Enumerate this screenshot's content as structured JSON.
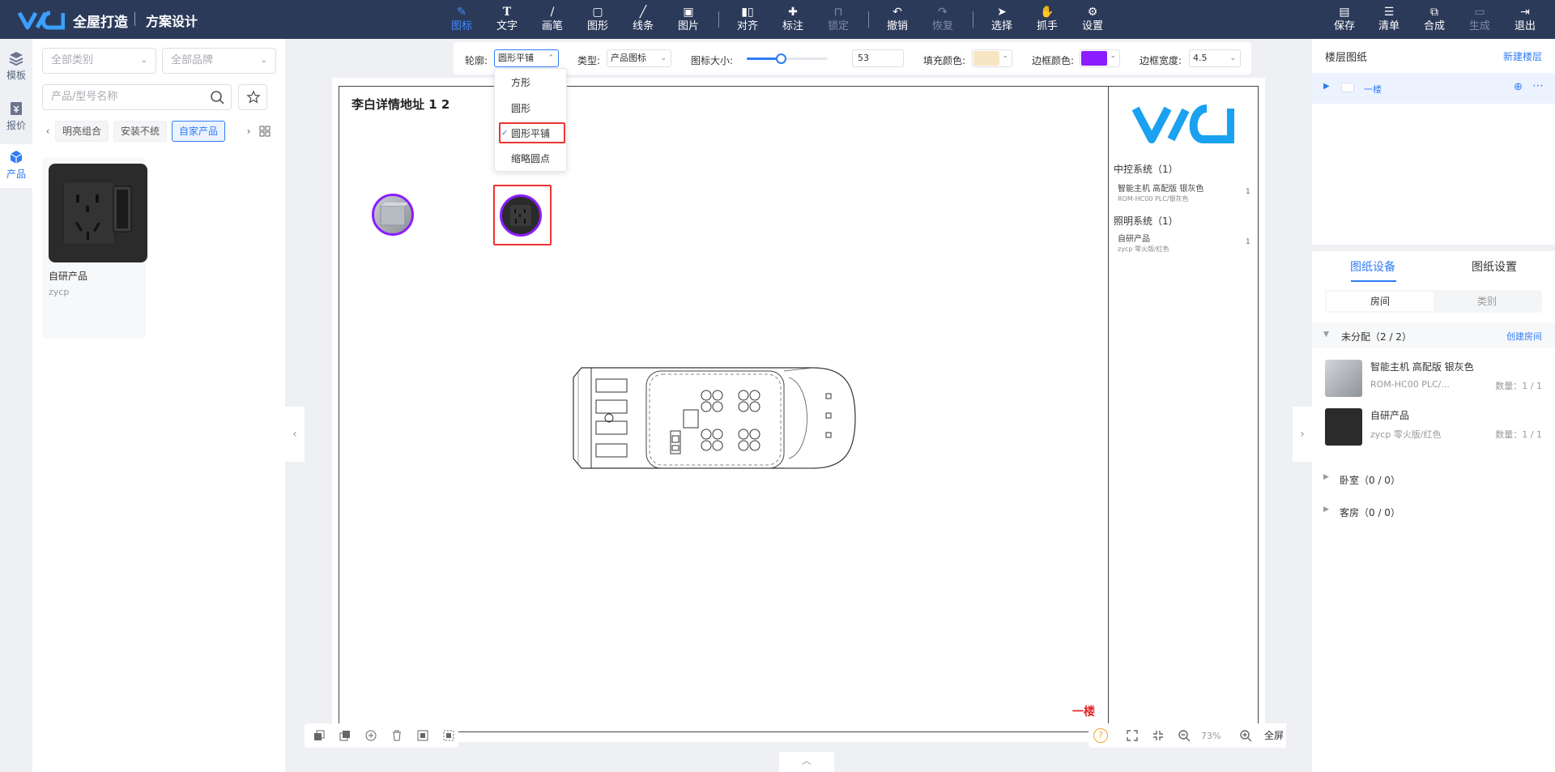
{
  "header": {
    "app_title": "全屋打造",
    "page_title": "方案设计"
  },
  "toolbar": {
    "tools": [
      {
        "id": "icon",
        "label": "图标",
        "icon": "icon-tool-icon",
        "active": true
      },
      {
        "id": "text",
        "label": "文字",
        "icon": "text-icon"
      },
      {
        "id": "brush",
        "label": "画笔",
        "icon": "brush-icon"
      },
      {
        "id": "shape",
        "label": "图形",
        "icon": "shape-icon"
      },
      {
        "id": "line",
        "label": "线条",
        "icon": "line-icon"
      },
      {
        "id": "image",
        "label": "图片",
        "icon": "image-icon"
      },
      {
        "id": "align",
        "label": "对齐",
        "icon": "align-icon"
      },
      {
        "id": "annotate",
        "label": "标注",
        "icon": "pin-icon"
      },
      {
        "id": "lock",
        "label": "锁定",
        "icon": "lock-icon",
        "disabled": true
      },
      {
        "id": "undo",
        "label": "撤销",
        "icon": "undo-icon"
      },
      {
        "id": "redo",
        "label": "恢复",
        "icon": "redo-icon",
        "disabled": true
      },
      {
        "id": "select",
        "label": "选择",
        "icon": "cursor-icon"
      },
      {
        "id": "grab",
        "label": "抓手",
        "icon": "hand-icon"
      },
      {
        "id": "settings",
        "label": "设置",
        "icon": "gear-icon"
      }
    ],
    "right": [
      {
        "id": "save",
        "label": "保存",
        "icon": "save-icon"
      },
      {
        "id": "list",
        "label": "清单",
        "icon": "list-icon"
      },
      {
        "id": "merge",
        "label": "合成",
        "icon": "merge-icon"
      },
      {
        "id": "generate",
        "label": "生成",
        "icon": "generate-icon",
        "disabled": true
      },
      {
        "id": "exit",
        "label": "退出",
        "icon": "exit-icon"
      }
    ]
  },
  "rail": [
    {
      "label": "模板",
      "icon": "layers-icon"
    },
    {
      "label": "报价",
      "icon": "quote-icon"
    },
    {
      "label": "产品",
      "icon": "cube-icon",
      "active": true
    }
  ],
  "left_panel": {
    "category_placeholder": "全部类别",
    "brand_placeholder": "全部品牌",
    "search_placeholder": "产品/型号名称",
    "tags": [
      "明亮组合",
      "安装不统",
      "自家产品"
    ],
    "active_tag": "自家产品",
    "product": {
      "name": "自研产品",
      "code": "zycp"
    }
  },
  "props": {
    "outline_label": "轮廓:",
    "outline_value": "圆形平铺",
    "type_label": "类型:",
    "type_value": "产品图标",
    "size_label": "图标大小:",
    "size_value": "53",
    "size_slider_fraction": 0.53,
    "fill_label": "填充颜色:",
    "fill_color": "#f7e6c4",
    "border_label": "边框颜色:",
    "border_color": "#8b1dff",
    "border_width_label": "边框宽度:",
    "border_width_value": "4.5"
  },
  "outline_dropdown": {
    "options": [
      "方形",
      "圆形",
      "圆形平铺",
      "缩略圆点"
    ],
    "selected": "圆形平铺"
  },
  "drawing": {
    "title": "李白详情地址 1 2",
    "floor_label": "一楼",
    "legend": [
      {
        "group": "中控系统（1）",
        "item": "智能主机 高配版 银灰色",
        "sub": "ROM-HC00 PLC/银灰色",
        "qty": "1"
      },
      {
        "group": "照明系统（1）",
        "item": "自研产品",
        "sub": "zycp 零火版/红色",
        "qty": "1"
      }
    ]
  },
  "zoom": {
    "percent": "73%",
    "fullscreen_label": "全屏"
  },
  "right_panel": {
    "floors_title": "楼层图纸",
    "new_floor": "新建楼层",
    "floor_name": "一楼",
    "tabs": [
      "图纸设备",
      "图纸设置"
    ],
    "segments": [
      "房间",
      "类别"
    ],
    "group_title": "未分配（2 / 2）",
    "create_room": "创建房间",
    "devices": [
      {
        "name": "智能主机 高配版 银灰色",
        "code": "ROM-HC00 PLC/...",
        "qty": "数量：1 / 1"
      },
      {
        "name": "自研产品",
        "code": "zycp 零火版/红色",
        "qty": "数量：1 / 1"
      }
    ],
    "rooms": [
      "卧室（0 / 0）",
      "客房（0 / 0）"
    ]
  }
}
